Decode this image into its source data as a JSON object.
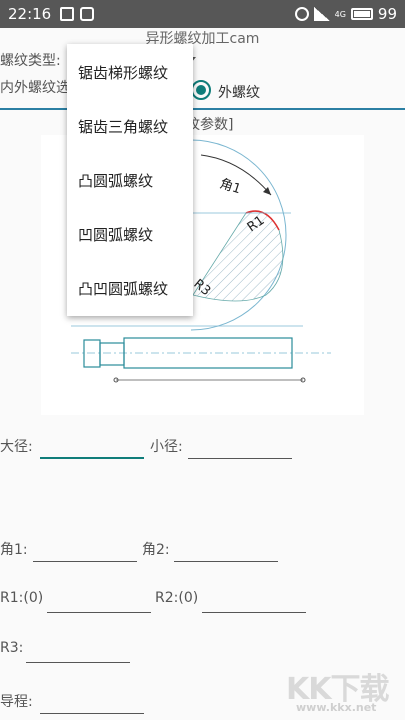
{
  "status_bar": {
    "time": "22:16",
    "network": "4G",
    "battery": "99"
  },
  "app": {
    "title": "异形螺纹加工cam"
  },
  "form": {
    "thread_type_label": "螺纹类型:",
    "inner_outer_label": "内外螺纹选",
    "radio_outer_label": "外螺纹",
    "section_title": "纹参数]"
  },
  "dropdown": {
    "items": [
      "锯齿梯形螺纹",
      "锯齿三角螺纹",
      "凸圆弧螺纹",
      "凹圆弧螺纹",
      "凸凹圆弧螺纹"
    ]
  },
  "diagram": {
    "labels": {
      "angle1": "角1",
      "r1": "R1",
      "r3": "R3"
    }
  },
  "fields": {
    "major_diameter": "大径:",
    "minor_diameter": "小径:",
    "angle1": "角1:",
    "angle2": "角2:",
    "r1": "R1:(0)",
    "r2": "R2:(0)",
    "r3": "R3:",
    "lead": "导程:"
  },
  "watermark": {
    "logo": "KK下载",
    "url": "www.kkx.net"
  },
  "colors": {
    "accent": "#0f7d7a",
    "divider": "#2b7fa3",
    "status_bar": "#575757"
  }
}
